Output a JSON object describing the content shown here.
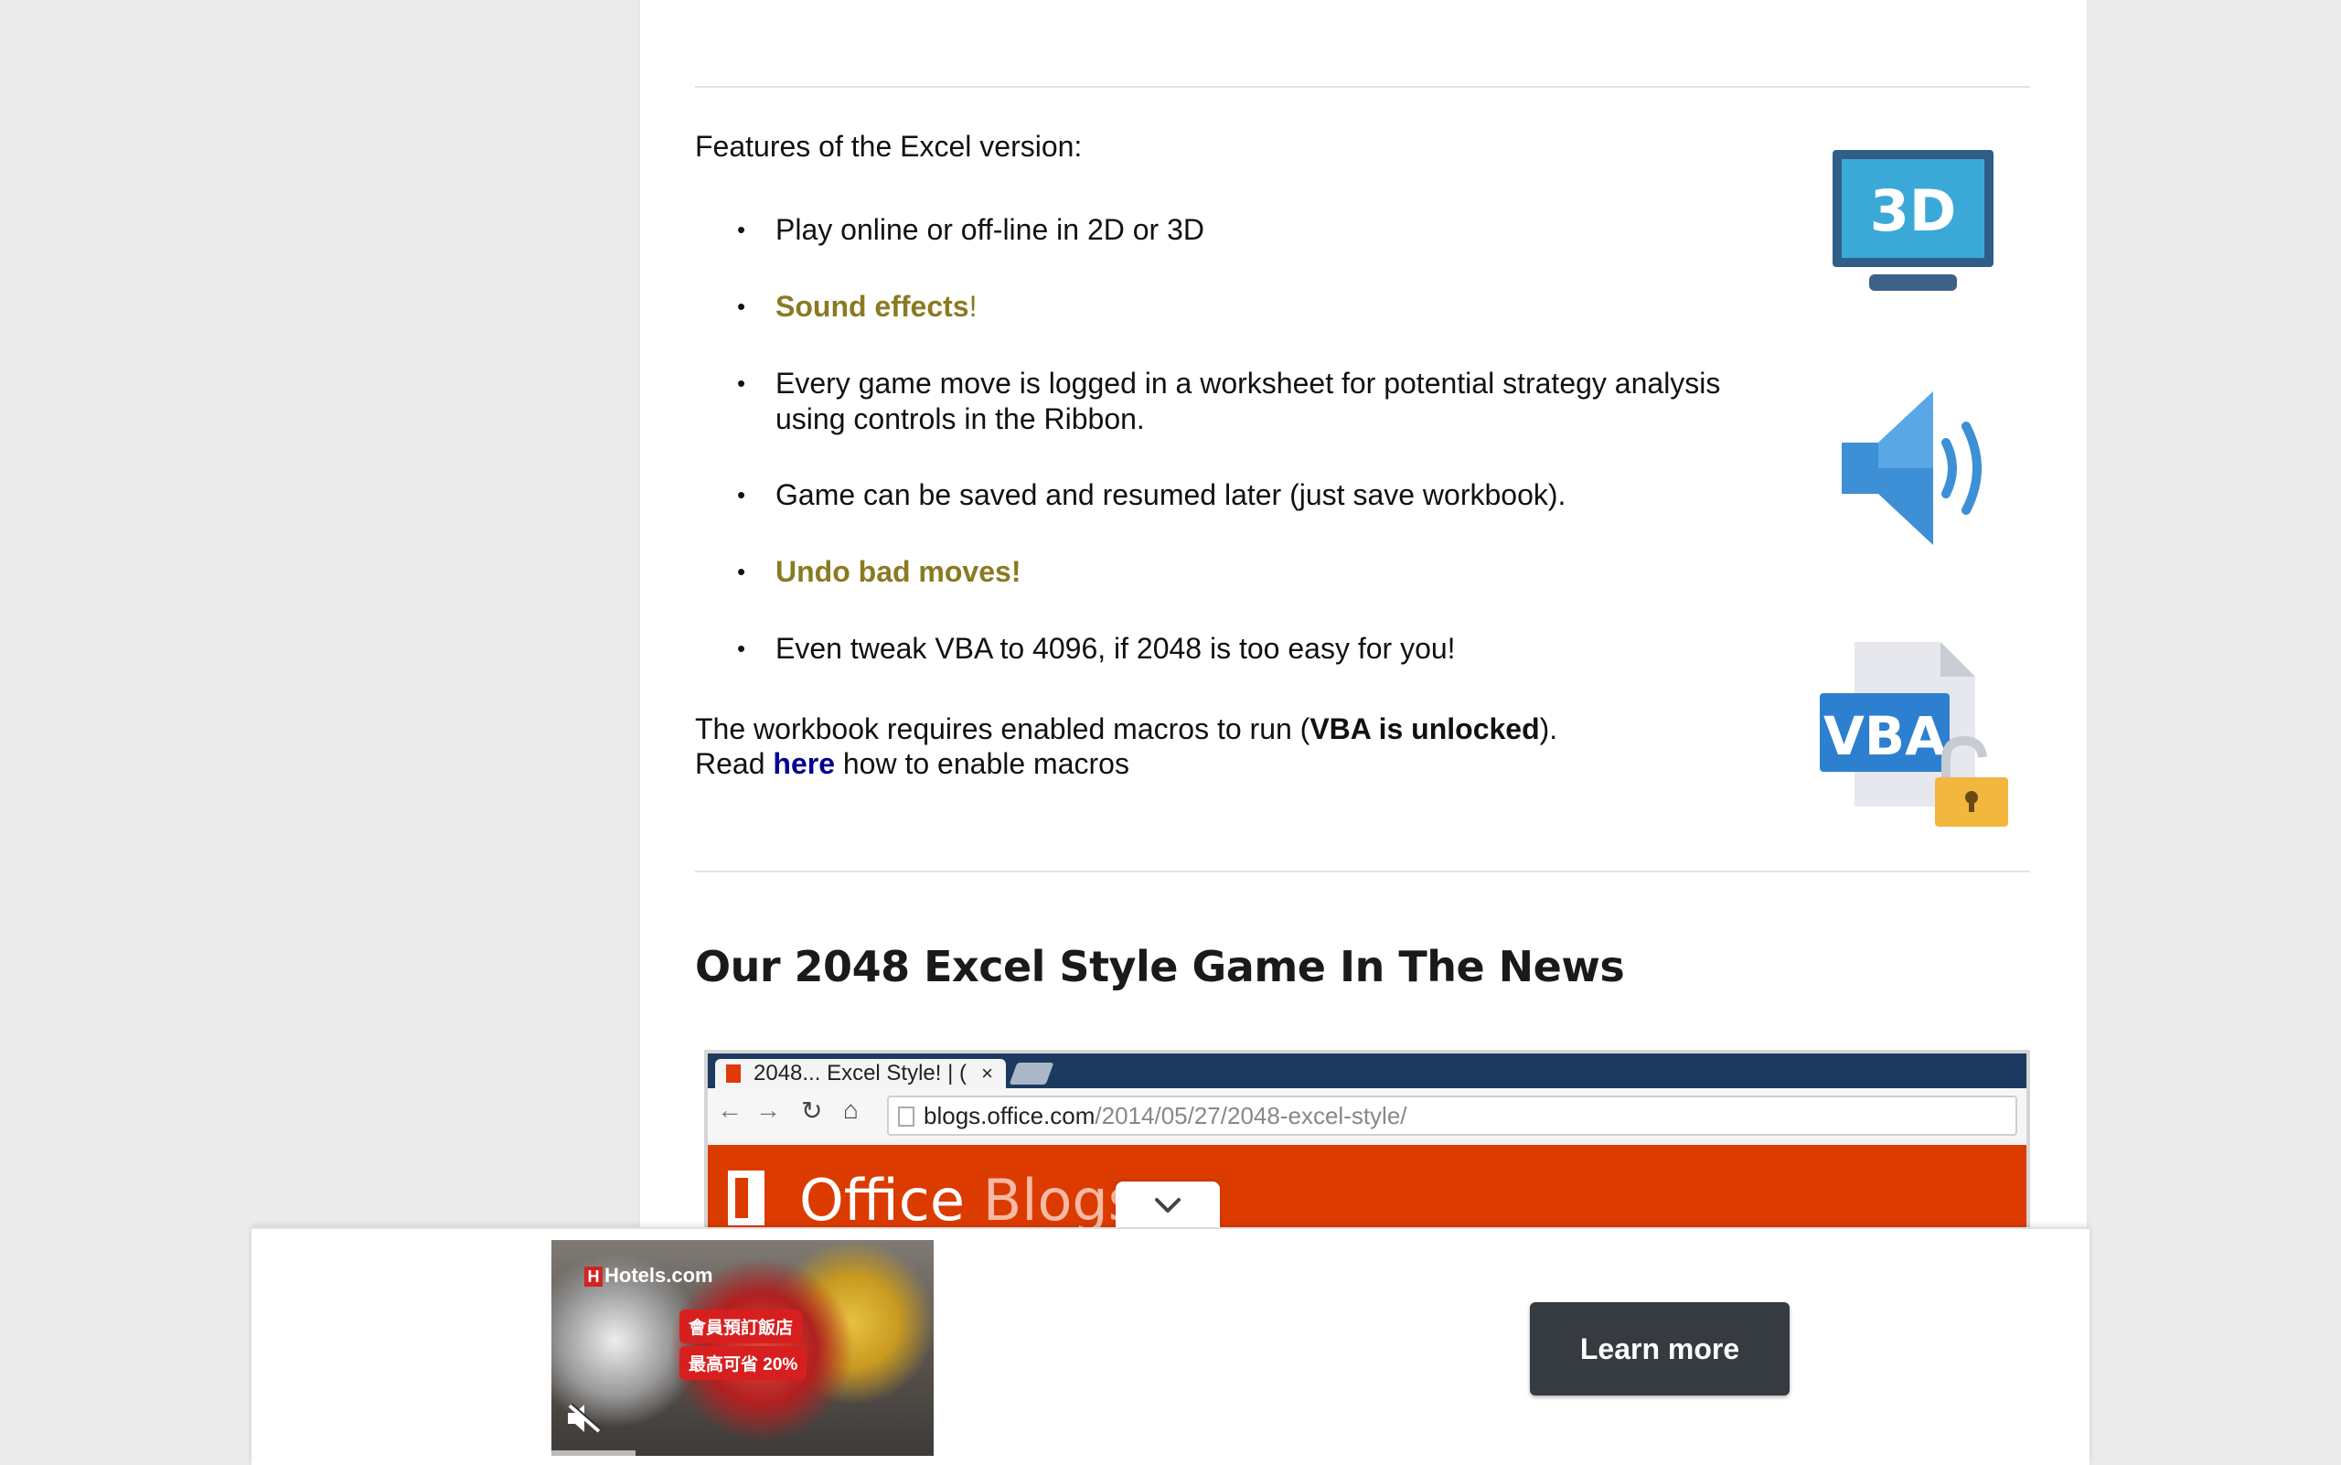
{
  "article": {
    "features_intro": "Features of the Excel version:",
    "features": [
      {
        "text": "Play online or off-line in 2D or 3D",
        "highlight": false
      },
      {
        "text": "Sound effects",
        "suffix": "!",
        "highlight": true
      },
      {
        "text": "Every game move is logged in a worksheet for potential strategy analysis using controls in the Ribbon.",
        "highlight": false
      },
      {
        "text": "Game can be saved and resumed later (just save workbook).",
        "highlight": false
      },
      {
        "text": "Undo bad moves!",
        "highlight": true
      },
      {
        "text": "Even tweak VBA to 4096, if 2048 is too easy for you!",
        "highlight": false
      }
    ],
    "macros": {
      "line1_prefix": "The workbook requires enabled macros to run (",
      "line1_bold": "VBA is unlocked",
      "line1_suffix": ").",
      "line2_prefix": "Read ",
      "line2_link": "here",
      "line2_suffix": " how to enable macros"
    },
    "icons": {
      "monitor_label": "3D",
      "vba_label": "VBA",
      "monitor_color": "#3ba9d8",
      "speaker_color": "#3d8fd6",
      "vba_color": "#2d7fd0",
      "lock_color": "#f3b63f"
    },
    "news_title": "Our 2048 Excel Style Game In The News",
    "screenshot": {
      "tab_title": "2048... Excel Style! | (",
      "tab_close": "×",
      "url_host": "blogs.office.com",
      "url_path": "/2014/05/27/2048-excel-style/",
      "banner_text_bold": "Office",
      "banner_text_light": " Blogs",
      "banner_color": "#dc3b00"
    },
    "accent_text_color": "#8a7a22",
    "link_color": "#00008f"
  },
  "ad": {
    "brand": "Hotels.com",
    "brand_letter": "H",
    "tag1": "會員預訂飯店",
    "tag2": "最高可省 20%",
    "cta_label": "Learn more",
    "progress": 0.22
  }
}
